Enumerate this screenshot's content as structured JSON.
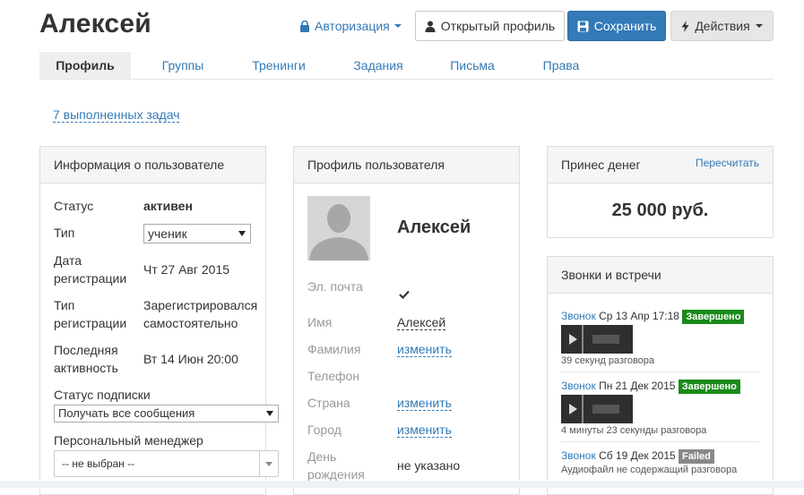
{
  "header": {
    "title": "Алексей",
    "auth_label": "Авторизация",
    "open_profile_label": "Открытый профиль",
    "save_label": "Сохранить",
    "actions_label": "Действия"
  },
  "tabs": [
    {
      "label": "Профиль",
      "active": true
    },
    {
      "label": "Группы"
    },
    {
      "label": "Тренинги"
    },
    {
      "label": "Задания"
    },
    {
      "label": "Письма"
    },
    {
      "label": "Права"
    }
  ],
  "tasks_link": "7 выполненных задач",
  "user_info": {
    "title": "Информация о пользователе",
    "status_label": "Статус",
    "status_value": "активен",
    "type_label": "Тип",
    "type_value": "ученик",
    "reg_date_label_1": "Дата",
    "reg_date_label_2": "регистрации",
    "reg_date_value": "Чт 27 Авг 2015",
    "reg_type_label_1": "Тип",
    "reg_type_label_2": "регистрации",
    "reg_type_value_1": "Зарегистрировался",
    "reg_type_value_2": "самостоятельно",
    "last_activity_label_1": "Последняя",
    "last_activity_label_2": "активность",
    "last_activity_value": "Вт 14 Июн 20:00",
    "subscription_label": "Статус подписки",
    "subscription_value": "Получать все сообщения",
    "manager_label": "Персональный менеджер",
    "manager_value": "-- не выбран --"
  },
  "profile": {
    "title": "Профиль пользователя",
    "name_heading": "Алексей",
    "email_label": "Эл. почта",
    "name_label": "Имя",
    "name_value": "Алексей",
    "surname_label": "Фамилия",
    "surname_value": "изменить",
    "phone_label": "Телефон",
    "country_label": "Страна",
    "country_value": "изменить",
    "city_label": "Город",
    "city_value": "изменить",
    "birthday_label_1": "День",
    "birthday_label_2": "рождения",
    "birthday_value": "не указано"
  },
  "money": {
    "title": "Принес денег",
    "recalc_label": "Пересчитать",
    "amount": "25 000 руб."
  },
  "calls": {
    "title": "Звонки и встречи",
    "items": [
      {
        "link": "Звонок",
        "date": "Ср 13 Апр 17:18",
        "status": "Завершено",
        "note": "39 секунд разговора"
      },
      {
        "link": "Звонок",
        "date": "Пн 21 Дек 2015",
        "status": "Завершено",
        "note": "4 минуты 23 секунды разговора"
      },
      {
        "link": "Звонок",
        "date": "Сб 19 Дек 2015",
        "status": "Failed",
        "note": "Аудиофайл не содержащий разговора"
      }
    ]
  },
  "colors": {
    "primary": "#337ab7",
    "success": "#1a8a1a",
    "muted": "#999999"
  }
}
